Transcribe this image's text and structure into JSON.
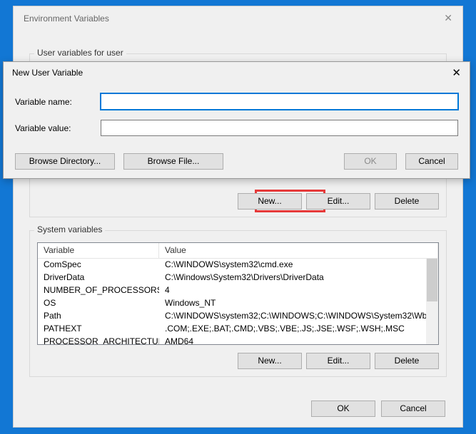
{
  "mainWindow": {
    "title": "Environment Variables",
    "userSectionTitle": "User variables for user",
    "sysSectionTitle": "System variables",
    "headers": {
      "variable": "Variable",
      "value": "Value"
    },
    "systemVars": [
      {
        "name": "ComSpec",
        "value": "C:\\WINDOWS\\system32\\cmd.exe"
      },
      {
        "name": "DriverData",
        "value": "C:\\Windows\\System32\\Drivers\\DriverData"
      },
      {
        "name": "NUMBER_OF_PROCESSORS",
        "value": "4"
      },
      {
        "name": "OS",
        "value": "Windows_NT"
      },
      {
        "name": "Path",
        "value": "C:\\WINDOWS\\system32;C:\\WINDOWS;C:\\WINDOWS\\System32\\Wb..."
      },
      {
        "name": "PATHEXT",
        "value": ".COM;.EXE;.BAT;.CMD;.VBS;.VBE;.JS;.JSE;.WSF;.WSH;.MSC"
      },
      {
        "name": "PROCESSOR_ARCHITECTURE",
        "value": "AMD64"
      }
    ],
    "buttons": {
      "new": "New...",
      "edit": "Edit...",
      "delete": "Delete",
      "ok": "OK",
      "cancel": "Cancel"
    }
  },
  "dialog": {
    "title": "New User Variable",
    "nameLabel": "Variable name:",
    "valueLabel": "Variable value:",
    "nameValue": "",
    "valueValue": "",
    "buttons": {
      "browseDir": "Browse Directory...",
      "browseFile": "Browse File...",
      "ok": "OK",
      "cancel": "Cancel"
    }
  }
}
